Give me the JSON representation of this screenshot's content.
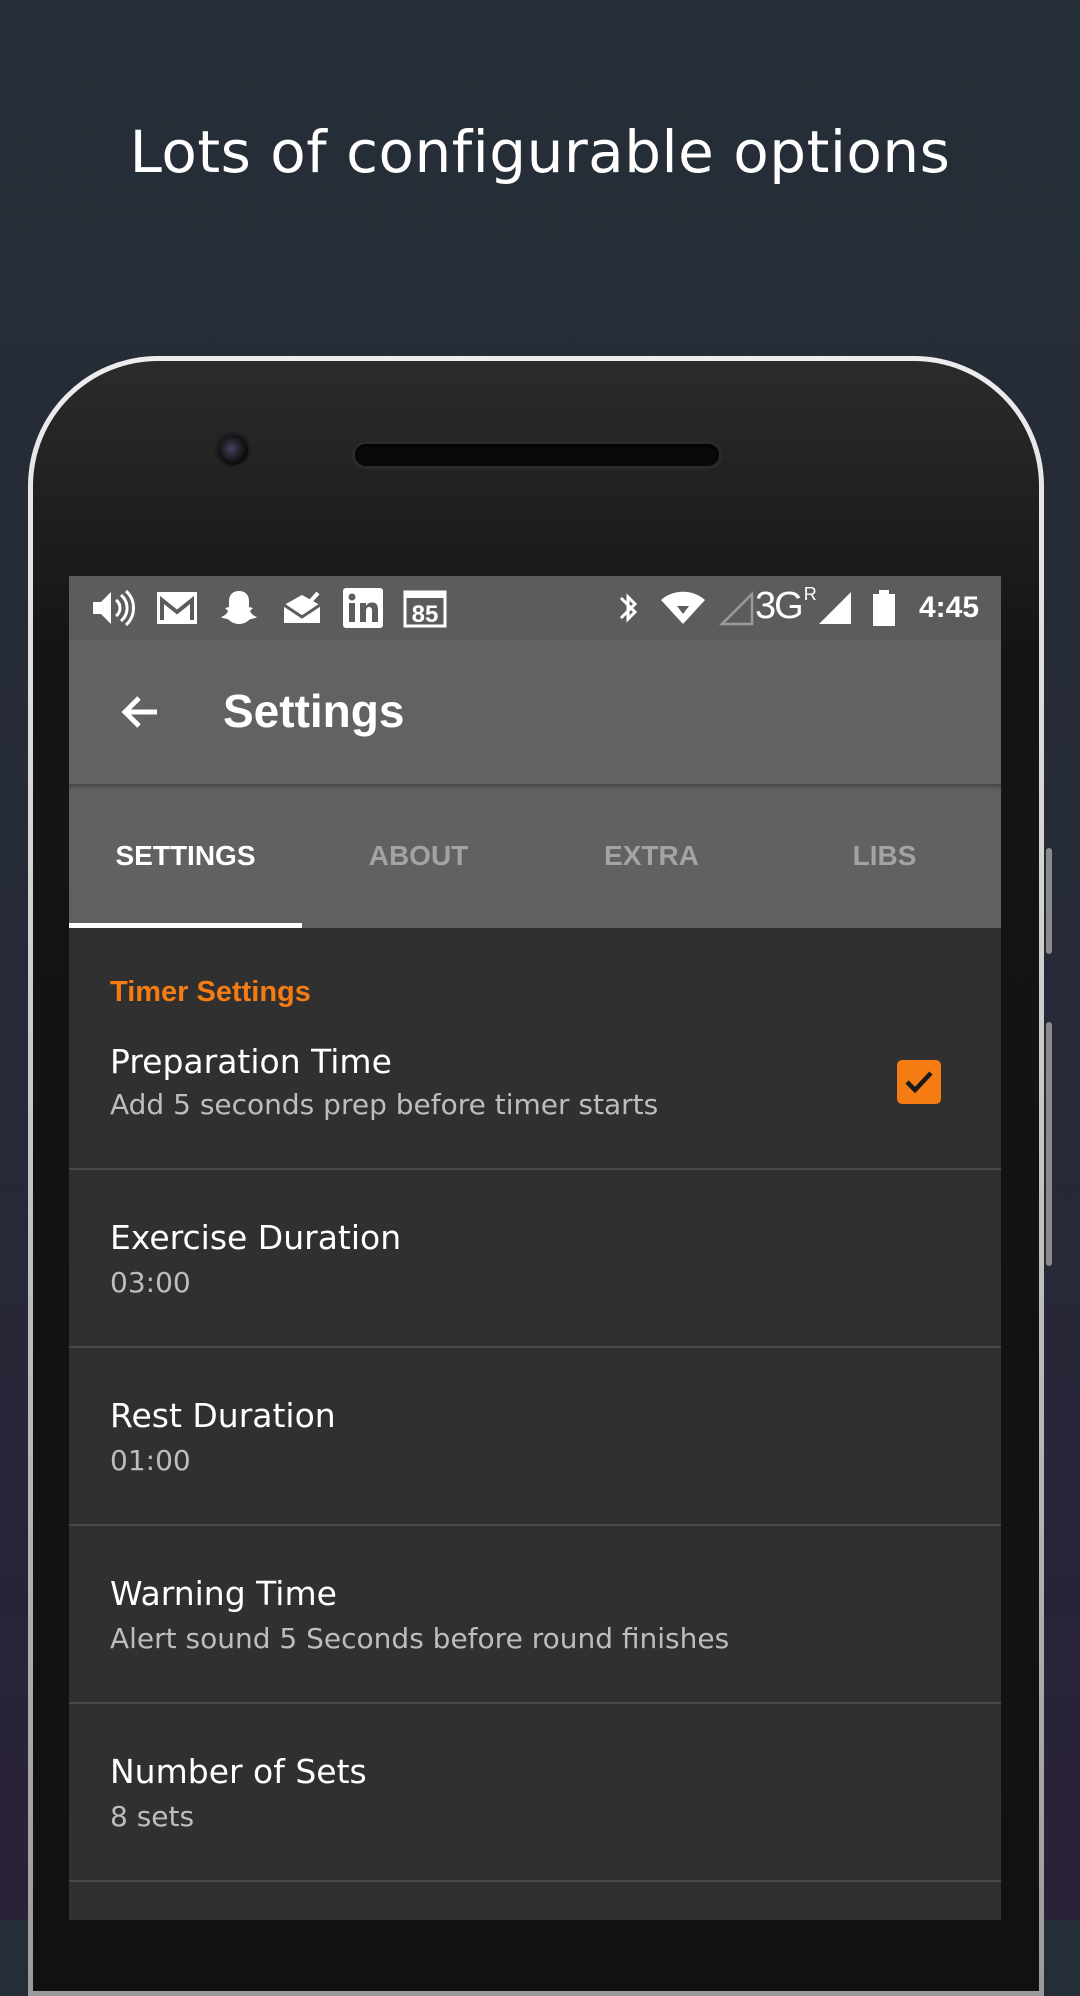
{
  "headline": "Lots of configurable options",
  "status_bar": {
    "left_icons": [
      "volume-icon",
      "gmail-icon",
      "snapchat-icon",
      "mail-check-icon",
      "linkedin-icon",
      "calendar-icon"
    ],
    "calendar_day": "85",
    "right_icons": [
      "bluetooth-icon",
      "wifi-icon",
      "signal-empty-icon",
      "network-3g-icon",
      "signal-full-icon",
      "battery-icon"
    ],
    "network_label": "3G",
    "roaming_label": "R",
    "time": "4:45"
  },
  "app_bar": {
    "back_icon": "arrow-back-icon",
    "title": "Settings"
  },
  "tabs": [
    {
      "label": "SETTINGS",
      "active": true
    },
    {
      "label": "ABOUT",
      "active": false
    },
    {
      "label": "EXTRA",
      "active": false
    },
    {
      "label": "LIBS",
      "active": false
    }
  ],
  "category": "Timer Settings",
  "preferences": [
    {
      "title": "Preparation Time",
      "summary": "Add 5 seconds prep before timer starts",
      "checked": true
    },
    {
      "title": "Exercise Duration",
      "summary": "03:00"
    },
    {
      "title": "Rest Duration",
      "summary": "01:00"
    },
    {
      "title": "Warning Time",
      "summary": "Alert sound 5 Seconds before round finishes"
    },
    {
      "title": "Number of Sets",
      "summary": "8 sets"
    }
  ],
  "colors": {
    "accent": "#f47c12",
    "toolbar": "#626262",
    "status_bar": "#5c5c5c",
    "background": "#303030"
  }
}
